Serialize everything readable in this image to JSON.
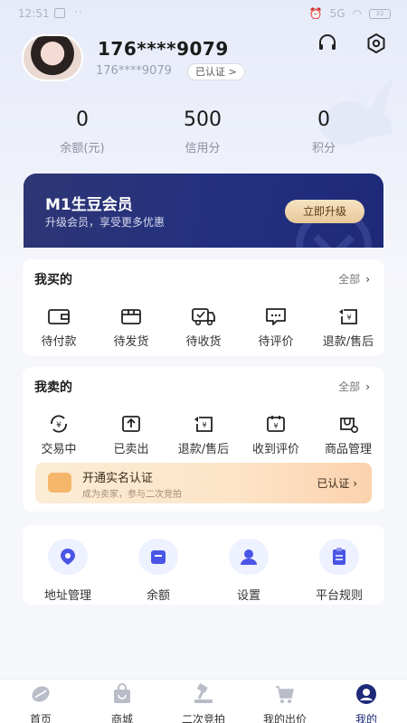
{
  "status_bar": {
    "time": "12:51",
    "dots": "··",
    "signal_text": "5G",
    "battery": "32"
  },
  "profile": {
    "username": "176****9079",
    "phone": "176****9079",
    "verified_label": "已认证 >"
  },
  "stats": [
    {
      "value": "0",
      "label": "余额(元)"
    },
    {
      "value": "500",
      "label": "信用分"
    },
    {
      "value": "0",
      "label": "积分"
    }
  ],
  "vip": {
    "title": "M1生豆会员",
    "subtitle": "升级会员，享受更多优惠",
    "button": "立即升级"
  },
  "buy": {
    "title": "我买的",
    "all": "全部",
    "items": [
      {
        "label": "待付款",
        "icon": "wallet-icon"
      },
      {
        "label": "待发货",
        "icon": "box-icon"
      },
      {
        "label": "待收货",
        "icon": "truck-icon"
      },
      {
        "label": "待评价",
        "icon": "comment-icon"
      },
      {
        "label": "退款/售后",
        "icon": "refund-icon"
      }
    ]
  },
  "sell": {
    "title": "我卖的",
    "all": "全部",
    "items": [
      {
        "label": "交易中",
        "icon": "yen-cycle-icon"
      },
      {
        "label": "已卖出",
        "icon": "upload-box-icon"
      },
      {
        "label": "退款/售后",
        "icon": "refund-icon"
      },
      {
        "label": "收到评价",
        "icon": "yen-calendar-icon"
      },
      {
        "label": "商品管理",
        "icon": "bag-settings-icon"
      }
    ],
    "realname": {
      "title": "开通实名认证",
      "subtitle": "成为卖家，参与二次竞拍",
      "status": "已认证"
    }
  },
  "tools": [
    {
      "label": "地址管理",
      "icon": "location-icon"
    },
    {
      "label": "余额",
      "icon": "wallet-icon"
    },
    {
      "label": "设置",
      "icon": "user-settings-icon"
    },
    {
      "label": "平台规则",
      "icon": "clipboard-icon"
    }
  ],
  "tabs": [
    {
      "label": "首页",
      "icon": "bean-icon"
    },
    {
      "label": "商城",
      "icon": "shopping-bag-icon"
    },
    {
      "label": "二次竞拍",
      "icon": "gavel-icon"
    },
    {
      "label": "我的出价",
      "icon": "cart-icon"
    },
    {
      "label": "我的",
      "icon": "profile-icon"
    }
  ],
  "colors": {
    "brand": "#1e2a78",
    "vip_button": "#f0d5ad",
    "accent": "#4a56e6"
  }
}
